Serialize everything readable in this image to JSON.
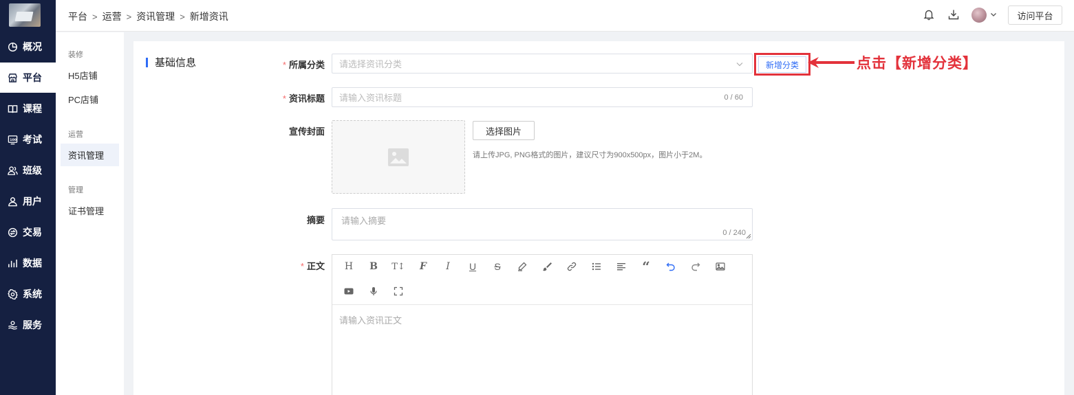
{
  "nav": {
    "items": [
      {
        "label": "概况",
        "icon": "pie-chart-icon"
      },
      {
        "label": "平台",
        "icon": "store-icon",
        "active": true
      },
      {
        "label": "课程",
        "icon": "book-icon"
      },
      {
        "label": "考试",
        "icon": "exam-icon"
      },
      {
        "label": "班级",
        "icon": "class-icon"
      },
      {
        "label": "用户",
        "icon": "user-icon"
      },
      {
        "label": "交易",
        "icon": "exchange-icon"
      },
      {
        "label": "数据",
        "icon": "bar-chart-icon"
      },
      {
        "label": "系统",
        "icon": "gear-icon"
      },
      {
        "label": "服务",
        "icon": "service-icon"
      }
    ]
  },
  "header": {
    "breadcrumb": [
      "平台",
      "运营",
      "资讯管理",
      "新增资讯"
    ],
    "visit_label": "访问平台"
  },
  "submenu": {
    "groups": [
      {
        "title": "装修",
        "items": [
          "H5店铺",
          "PC店铺"
        ]
      },
      {
        "title": "运营",
        "items": [
          "资讯管理"
        ]
      },
      {
        "title": "管理",
        "items": [
          "证书管理"
        ]
      }
    ],
    "active": "资讯管理"
  },
  "form": {
    "section_title": "基础信息",
    "category": {
      "label": "所属分类",
      "placeholder": "请选择资讯分类",
      "add_label": "新增分类"
    },
    "title": {
      "label": "资讯标题",
      "placeholder": "请输入资讯标题",
      "counter": "0 / 60"
    },
    "cover": {
      "label": "宣传封面",
      "button": "选择图片",
      "hint": "请上传JPG, PNG格式的图片，建议尺寸为900x500px，图片小于2M。"
    },
    "summary": {
      "label": "摘要",
      "placeholder": "请输入摘要",
      "counter": "0 / 240"
    },
    "body": {
      "label": "正文",
      "placeholder": "请输入资讯正文"
    }
  },
  "annotation": {
    "text": "点击【新增分类】",
    "color": "#e3323b"
  },
  "colors": {
    "nav_bg": "#152041",
    "accent": "#2f6cf6",
    "required": "#f56c6c"
  }
}
